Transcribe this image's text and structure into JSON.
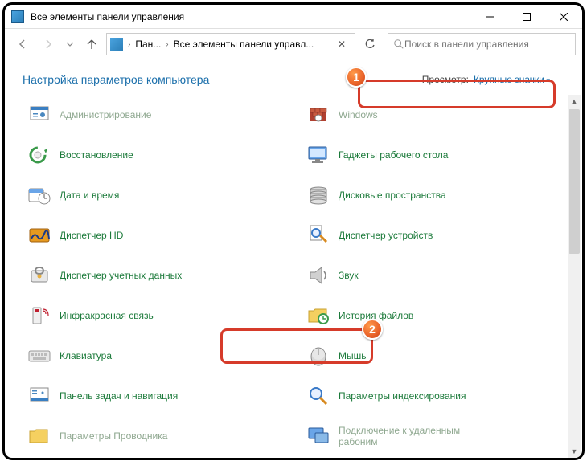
{
  "window": {
    "title": "Все элементы панели управления"
  },
  "breadcrumb": {
    "seg1": "Пан...",
    "seg2": "Все элементы панели управл..."
  },
  "search": {
    "placeholder": "Поиск в панели управления"
  },
  "header": {
    "title": "Настройка параметров компьютера",
    "view_label": "Просмотр:",
    "view_value": "Крупные значки"
  },
  "markers": {
    "m1": "1",
    "m2": "2"
  },
  "items": {
    "c0r0": "Администрирование",
    "c1r0": "Windows",
    "c0r1": "Восстановление",
    "c1r1": "Гаджеты рабочего стола",
    "c0r2": "Дата и время",
    "c1r2": "Дисковые пространства",
    "c0r3": "Диспетчер HD",
    "c1r3": "Диспетчер устройств",
    "c0r4": "Диспетчер учетных данных",
    "c1r4": "Звук",
    "c0r5": "Инфракрасная связь",
    "c1r5": "История файлов",
    "c0r6": "Клавиатура",
    "c1r6": "Мышь",
    "c0r7": "Панель задач и навигация",
    "c1r7": "Параметры индексирования",
    "c0r8": "Параметры Проводника",
    "c1r8": "Подключение к удаленным рабоним"
  }
}
